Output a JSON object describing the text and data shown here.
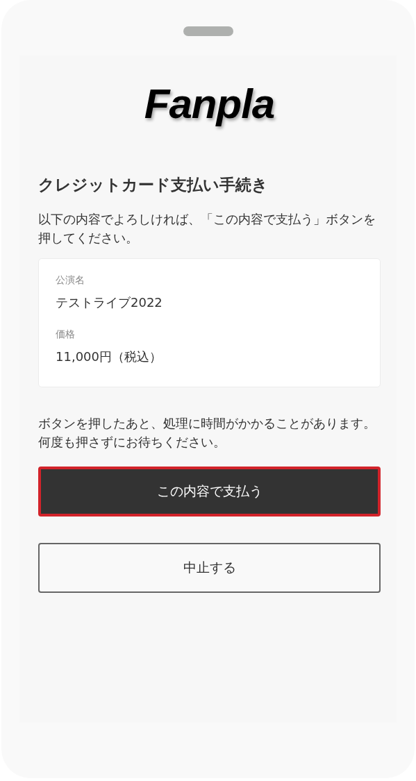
{
  "logo": {
    "text": "Fanpla"
  },
  "title": "クレジットカード支払い手続き",
  "intro": "以下の内容でよろしければ、「この内容で支払う」ボタンを押してください。",
  "details": [
    {
      "label": "公演名",
      "value": "テストライブ2022"
    },
    {
      "label": "価格",
      "value": "11,000円（税込）"
    }
  ],
  "notice": "ボタンを押したあと、処理に時間がかかることがあります。何度も押さずにお待ちください。",
  "buttons": [
    {
      "kind": "primary",
      "label": "この内容で支払う",
      "highlighted": true
    },
    {
      "kind": "secondary",
      "label": "中止する",
      "highlighted": false
    }
  ]
}
